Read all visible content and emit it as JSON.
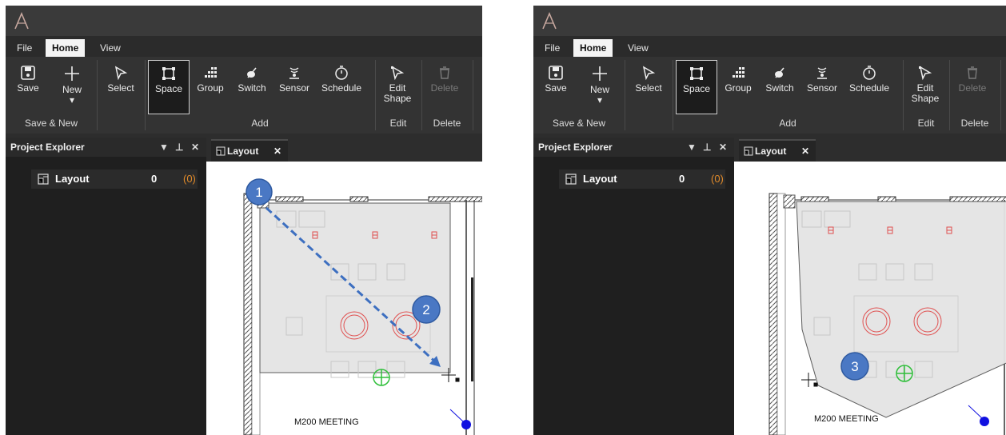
{
  "ribbon": {
    "tabs": [
      "File",
      "Home",
      "View"
    ],
    "active_tab": "Home",
    "buttons": {
      "save": "Save",
      "new": "New",
      "select": "Select",
      "space": "Space",
      "group": "Group",
      "switch": "Switch",
      "sensor": "Sensor",
      "schedule": "Schedule",
      "edit_shape_1": "Edit",
      "edit_shape_2": "Shape",
      "delete": "Delete"
    },
    "groups": {
      "save_new": "Save & New",
      "add": "Add",
      "edit": "Edit",
      "delete": "Delete"
    }
  },
  "project_explorer": {
    "title": "Project Explorer",
    "item": {
      "name": "Layout",
      "count": "0",
      "sub_count": "(0)"
    }
  },
  "document_tab": {
    "label": "Layout",
    "close": "✕"
  },
  "floorplan": {
    "room_label": "M200 MEETING",
    "markers": {
      "left": [
        "1",
        "2"
      ],
      "right": [
        "3"
      ]
    }
  },
  "colors": {
    "marker_fill": "#4a78c4",
    "arrow": "#3d6fc0",
    "accent_orange": "#e08a2a",
    "sensor_green": "#2fbf3a",
    "light_fixture_red": "#e05050",
    "device_blue": "#1010e0"
  }
}
